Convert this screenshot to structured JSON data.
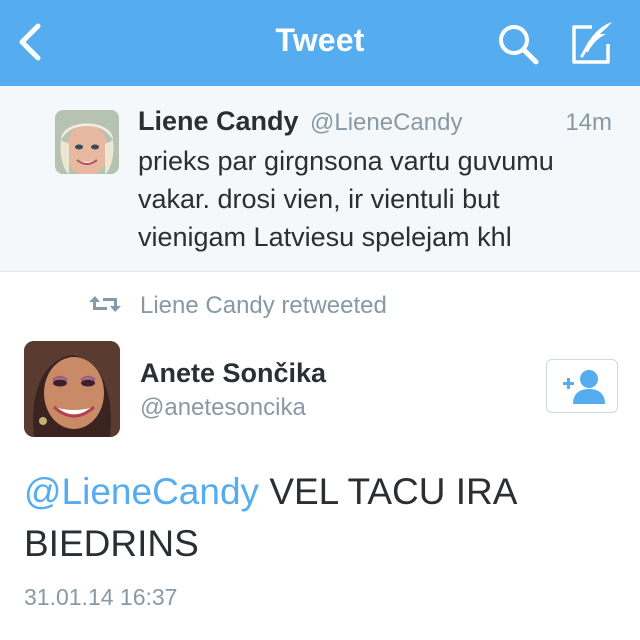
{
  "navbar": {
    "title": "Tweet",
    "back_icon": "chevron-left-icon",
    "search_icon": "search-icon",
    "compose_icon": "compose-icon",
    "background_color": "#55acee"
  },
  "parent_tweet": {
    "name": "Liene Candy",
    "handle": "@LieneCandy",
    "time": "14m",
    "text": "prieks par girgnsona vartu guvumu vakar. drosi vien, ir vientuli but vienigam Latviesu spelejam khl"
  },
  "retweet_context": {
    "icon": "retweet-icon",
    "label": "Liene Candy retweeted"
  },
  "main_tweet": {
    "name": "Anete Sončika",
    "handle": "@anetesoncika",
    "follow_icon": "add-user-icon",
    "mention": "@LieneCandy",
    "text": " VEL TACU IRA BIEDRINS",
    "timestamp": "31.01.14 16:37"
  },
  "colors": {
    "accent": "#55acee",
    "text": "#292f33",
    "secondary_text": "#8899a6"
  }
}
